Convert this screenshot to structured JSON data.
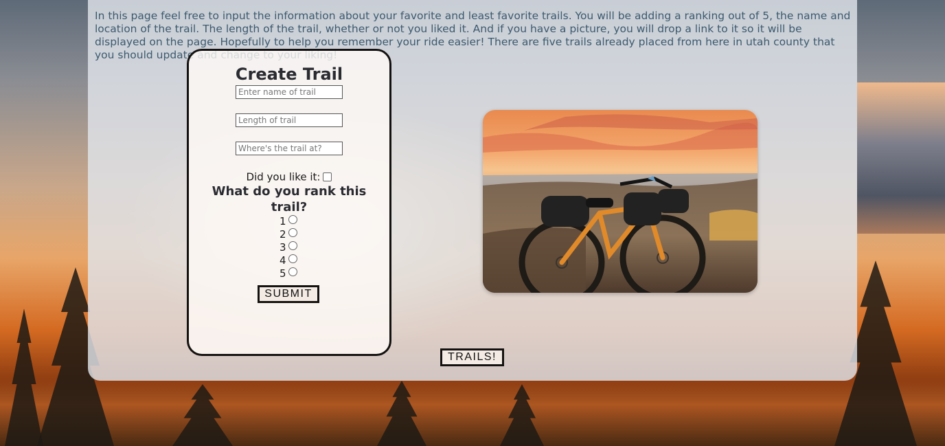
{
  "intro": {
    "text": "In this page feel free to input the information about your favorite and least favorite trails. You will be adding a ranking out of 5, the name and location of the trail. The length of the trail, whether or not you liked it. And if you have a picture, you will drop a link to it so it will be displayed on the page. Hopefully to help you remember your ride easier! There are five trails already placed from here in utah county that you should update and change to your liking!"
  },
  "form": {
    "title": "Create Trail",
    "name_placeholder": "Enter name of trail",
    "length_placeholder": "Length of trail",
    "location_placeholder": "Where's the trail at?",
    "liked_label": "Did you like it:",
    "liked_checked": false,
    "rank_title": "What do you rank this trail?",
    "rank_options": [
      "1",
      "2",
      "3",
      "4",
      "5"
    ],
    "submit_label": "SUBMIT"
  },
  "trails_button_label": "TRAILS!",
  "icons": {
    "photo": "mountain-bike-sunset-photo"
  },
  "colors": {
    "intro_text": "#3c5a6e",
    "heading_text": "#2a2b31",
    "card_border": "#141210"
  }
}
